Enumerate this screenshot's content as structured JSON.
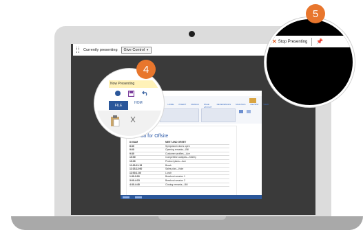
{
  "present_bar": {
    "currently_presenting_label": "Currently presenting",
    "give_control_label": "Give Control"
  },
  "stop_bar": {
    "stop_presenting_label": "Stop Presenting"
  },
  "magnifier": {
    "banner_text": "Now Presenting",
    "file_tab_label": "FILE",
    "home_tab_label": "HOM"
  },
  "steps": {
    "step_left": "4",
    "step_right": "5"
  },
  "document": {
    "ribbon_tabs": [
      "FILE",
      "HOME",
      "INSERT",
      "DESIGN",
      "PAGE LAYOUT",
      "REFERENCES",
      "MAILINGS",
      "REVIEW",
      "VIEW"
    ],
    "title": "Agenda for Offsite",
    "agenda": [
      {
        "time": "8:00AM",
        "session": "MEET AND GREET"
      },
      {
        "time": "8:30",
        "session": "Symposium doors open"
      },
      {
        "time": "9:00",
        "session": "Opening remarks—Bill"
      },
      {
        "time": "9:30",
        "session": "Customer profiles—Ace"
      },
      {
        "time": "10:00",
        "session": "Competitive analysis—Shirley"
      },
      {
        "time": "10:30",
        "session": "Product plans—Ace"
      },
      {
        "time": "11:00-11:15",
        "session": "Break"
      },
      {
        "time": "11:15-12:00",
        "session": "Sales plan—Kate"
      },
      {
        "time": "12:00-1:30",
        "session": "Lunch"
      },
      {
        "time": "1:30-3:00",
        "session": "Breakout session 1"
      },
      {
        "time": "3:00-4:15",
        "session": "Breakout session 2"
      },
      {
        "time": "4:30-4:45",
        "session": "Closing remarks—Bill"
      }
    ]
  },
  "colors": {
    "accent_orange": "#e8762d",
    "word_blue": "#2b579a",
    "stop_x": "#e25a1c"
  },
  "icons": [
    "grip-icon",
    "dropdown-arrow-icon",
    "close-x-icon",
    "pin-icon",
    "save-icon",
    "undo-icon",
    "paste-icon",
    "cut-icon"
  ]
}
